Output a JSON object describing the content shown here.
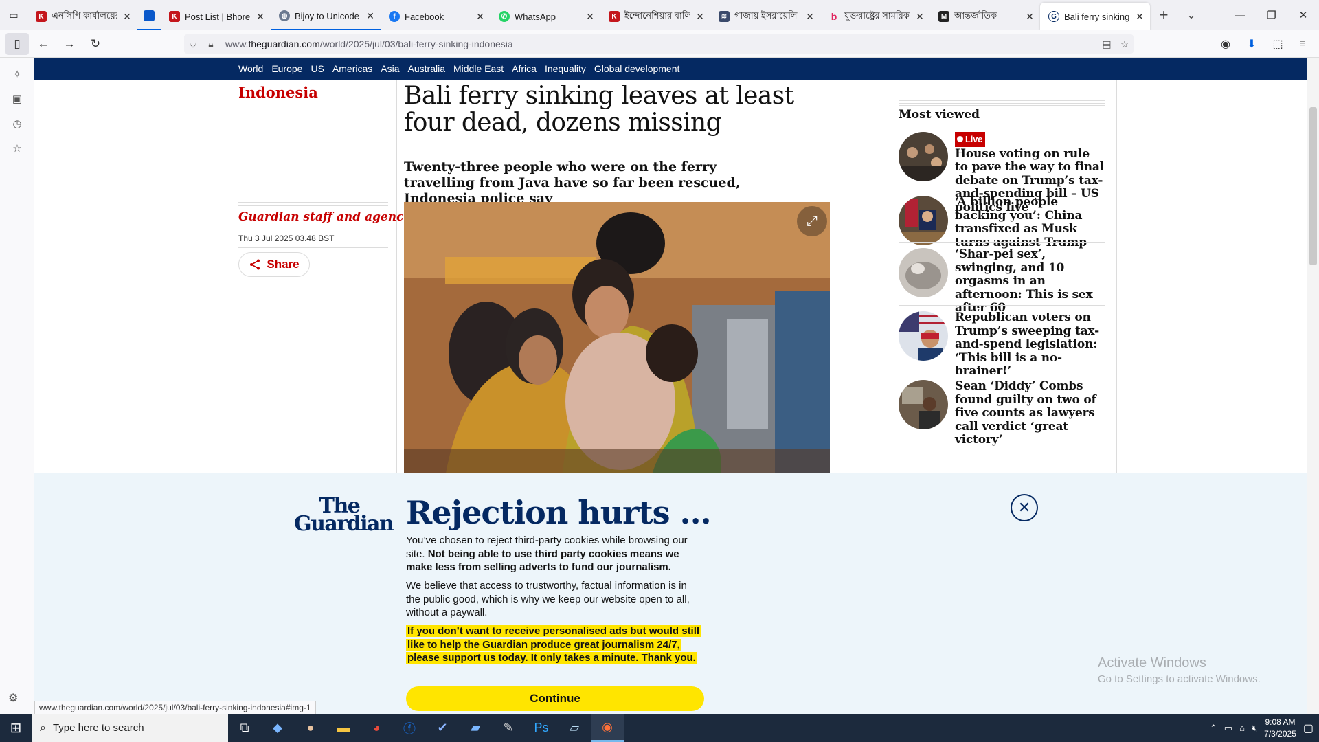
{
  "browser": {
    "tabs": [
      {
        "label": "এনসিপি কার্যালয়ের",
        "favicon": "bhorer-kagoj-icon"
      },
      {
        "label": "",
        "favicon": "blue-square-icon"
      },
      {
        "label": "Post List | Bhorer K",
        "favicon": "bhorer-kagoj-icon"
      },
      {
        "label": "Bijoy to Unicode w",
        "favicon": "globe-icon"
      },
      {
        "label": "Facebook",
        "favicon": "facebook-icon"
      },
      {
        "label": "WhatsApp",
        "favicon": "whatsapp-icon"
      },
      {
        "label": "ইন্দোনেশিয়ার বালিতে",
        "favicon": "bhorer-kagoj-icon"
      },
      {
        "label": "গাজায় ইসরায়েলি হা",
        "favicon": "news-icon"
      },
      {
        "label": "যুক্তরাষ্ট্রের সামরিক",
        "favicon": "b-icon"
      },
      {
        "label": "আন্তর্জাতিক",
        "favicon": "m-icon"
      },
      {
        "label": "Bali ferry sinking le",
        "favicon": "guardian-icon"
      }
    ],
    "url_prefix": "www.",
    "url_domain": "theguardian.com",
    "url_path": "/world/2025/jul/03/bali-ferry-sinking-indonesia",
    "status_url": "www.theguardian.com/world/2025/jul/03/bali-ferry-sinking-indonesia#img-1"
  },
  "guardian_nav": [
    "World",
    "Europe",
    "US",
    "Americas",
    "Asia",
    "Australia",
    "Middle East",
    "Africa",
    "Inequality",
    "Global development"
  ],
  "article": {
    "section": "Indonesia",
    "headline": "Bali ferry sinking leaves at least four dead, dozens missing",
    "standfirst": "Twenty-three people who were on the ferry travelling from Java have so far been rescued, Indonesia police say",
    "byline": "Guardian staff and agencies",
    "date": "Thu 3 Jul 2025 03.48 BST",
    "share_label": "Share"
  },
  "most_viewed": {
    "title": "Most viewed",
    "live_label": "Live",
    "items": [
      {
        "text": "House voting on rule to pave the way to final debate on Trump’s tax-and-spending bill – US politics live",
        "live": true
      },
      {
        "text": "‘A billion people backing you’: China transfixed as Musk turns against Trump",
        "live": false
      },
      {
        "text": "‘Shar-pei sex’, swinging, and 10 orgasms in an afternoon: This is sex after 60",
        "live": false
      },
      {
        "text": "Republican voters on Trump’s sweeping tax-and-spend legislation: ‘This bill is a no-brainer!’",
        "live": false
      },
      {
        "text": "Sean ‘Diddy’ Combs found guilty on two of five counts as lawyers call verdict ‘great victory’",
        "live": false
      }
    ]
  },
  "consent": {
    "logo_line1": "The",
    "logo_line2": "Guardian",
    "title": "Rejection hurts ...",
    "para1_normal": "You’ve chosen to reject third-party cookies while browsing our site. ",
    "para1_bold": "Not being able to use third party cookies means we make less from selling adverts to fund our journalism.",
    "para2": "We believe that access to trustworthy, factual information is in the public good, which is why we keep our website open to all, without a paywall.",
    "para3": "If you don’t want to receive personalised ads but would still like to help the Guardian produce great journalism 24/7, please support us today. It only takes a minute. Thank you.",
    "continue_label": "Continue"
  },
  "watermark": {
    "line1": "Activate Windows",
    "line2": "Go to Settings to activate Windows."
  },
  "taskbar": {
    "search_placeholder": "Type here to search",
    "time": "9:08 AM",
    "date": "7/3/2025"
  },
  "colors": {
    "guardian_blue": "#052962",
    "guardian_red": "#c70000",
    "support_yellow": "#ffe500",
    "banner_bg": "#edf5fa"
  }
}
